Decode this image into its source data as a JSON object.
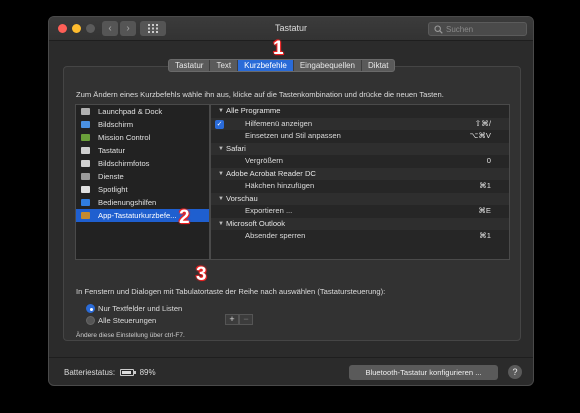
{
  "window": {
    "title": "Tastatur",
    "search_placeholder": "Suchen"
  },
  "tabs": [
    {
      "label": "Tastatur",
      "active": false
    },
    {
      "label": "Text",
      "active": false
    },
    {
      "label": "Kurzbefehle",
      "active": true
    },
    {
      "label": "Eingabequellen",
      "active": false
    },
    {
      "label": "Diktat",
      "active": false
    }
  ],
  "instruction": "Zum Ändern eines Kurzbefehls wähle ihn aus, klicke auf die Tastenkombination und drücke die neuen Tasten.",
  "categories": [
    {
      "label": "Launchpad & Dock",
      "icon": "launchpad-icon",
      "color": "#b0b0b0"
    },
    {
      "label": "Bildschirm",
      "icon": "display-icon",
      "color": "#4a90e2"
    },
    {
      "label": "Mission Control",
      "icon": "mission-control-icon",
      "color": "#6a9f3a"
    },
    {
      "label": "Tastatur",
      "icon": "keyboard-icon",
      "color": "#cfcfcf"
    },
    {
      "label": "Bildschirmfotos",
      "icon": "screenshot-icon",
      "color": "#d0d0d0"
    },
    {
      "label": "Dienste",
      "icon": "gear-icon",
      "color": "#9a9a9a"
    },
    {
      "label": "Spotlight",
      "icon": "spotlight-icon",
      "color": "#e0e0e0"
    },
    {
      "label": "Bedienungshilfen",
      "icon": "accessibility-icon",
      "color": "#2f7de1"
    },
    {
      "label": "App-Tastaturkurzbefe...",
      "icon": "app-shortcuts-icon",
      "color": "#c58a2f",
      "selected": true
    }
  ],
  "shortcuts": [
    {
      "label": "Alle Programme",
      "group": true,
      "key": ""
    },
    {
      "label": "Hilfemenü anzeigen",
      "checked": true,
      "key": "⇧⌘/"
    },
    {
      "label": "Einsetzen und Stil anpassen",
      "key": "⌥⌘V"
    },
    {
      "label": "Safari",
      "group": true,
      "key": ""
    },
    {
      "label": "Vergrößern",
      "key": "0"
    },
    {
      "label": "Adobe Acrobat Reader DC",
      "group": true,
      "key": ""
    },
    {
      "label": "Häkchen hinzufügen",
      "key": "⌘1"
    },
    {
      "label": "Vorschau",
      "group": true,
      "key": ""
    },
    {
      "label": "Exportieren ...",
      "key": "⌘E"
    },
    {
      "label": "Microsoft Outlook",
      "group": true,
      "key": ""
    },
    {
      "label": "Absender sperren",
      "key": "⌘1"
    }
  ],
  "buttons": {
    "plus": "+",
    "minus": "−",
    "bluetooth": "Bluetooth-Tastatur konfigurieren ...",
    "help": "?"
  },
  "full_keyboard": {
    "text": "In Fenstern und Dialogen mit Tabulatortaste der Reihe nach auswählen (Tastatursteuerung):",
    "options": [
      {
        "label": "Nur Textfelder und Listen",
        "selected": true
      },
      {
        "label": "Alle Steuerungen",
        "selected": false
      }
    ],
    "hint": "Ändere diese Einstellung über ctrl-F7."
  },
  "battery": {
    "label": "Batteriestatus:",
    "percent": "89%",
    "level": 0.89
  },
  "markers": [
    "1",
    "2",
    "3"
  ],
  "colors": {
    "accent": "#2a6bd8",
    "marker": "#e22222"
  }
}
